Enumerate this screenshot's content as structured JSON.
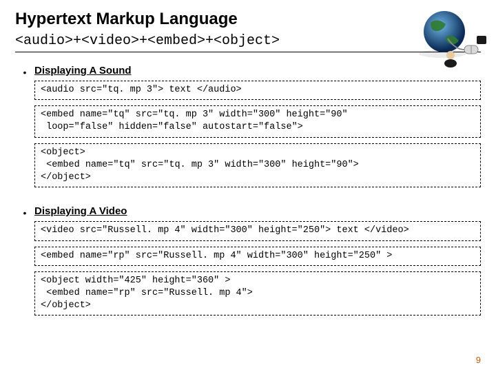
{
  "title": "Hypertext Markup Language",
  "subtitle": "<audio>+<video>+<embed>+<object>",
  "sections": [
    {
      "bullet": "•",
      "heading": "Displaying  A Sound",
      "boxes": [
        "<audio src=\"tq. mp 3\"> text </audio>",
        "<embed name=\"tq\" src=\"tq. mp 3\" width=\"300\" height=\"90\"\n loop=\"false\" hidden=\"false\" autostart=\"false\">",
        "<object>\n <embed name=\"tq\" src=\"tq. mp 3\" width=\"300\" height=\"90\">\n</object>"
      ]
    },
    {
      "bullet": "•",
      "heading": "Displaying  A Video",
      "boxes": [
        "<video src=\"Russell. mp 4\" width=\"300\" height=\"250\"> text </video>",
        "<embed name=\"rp\" src=\"Russell. mp 4\" width=\"300\" height=\"250\" >",
        "<object width=\"425\" height=\"360\" >\n <embed name=\"rp\" src=\"Russell. mp 4\">\n</object>"
      ]
    }
  ],
  "page_number": "9",
  "icons": {
    "globe": "globe-mouse-icon"
  }
}
